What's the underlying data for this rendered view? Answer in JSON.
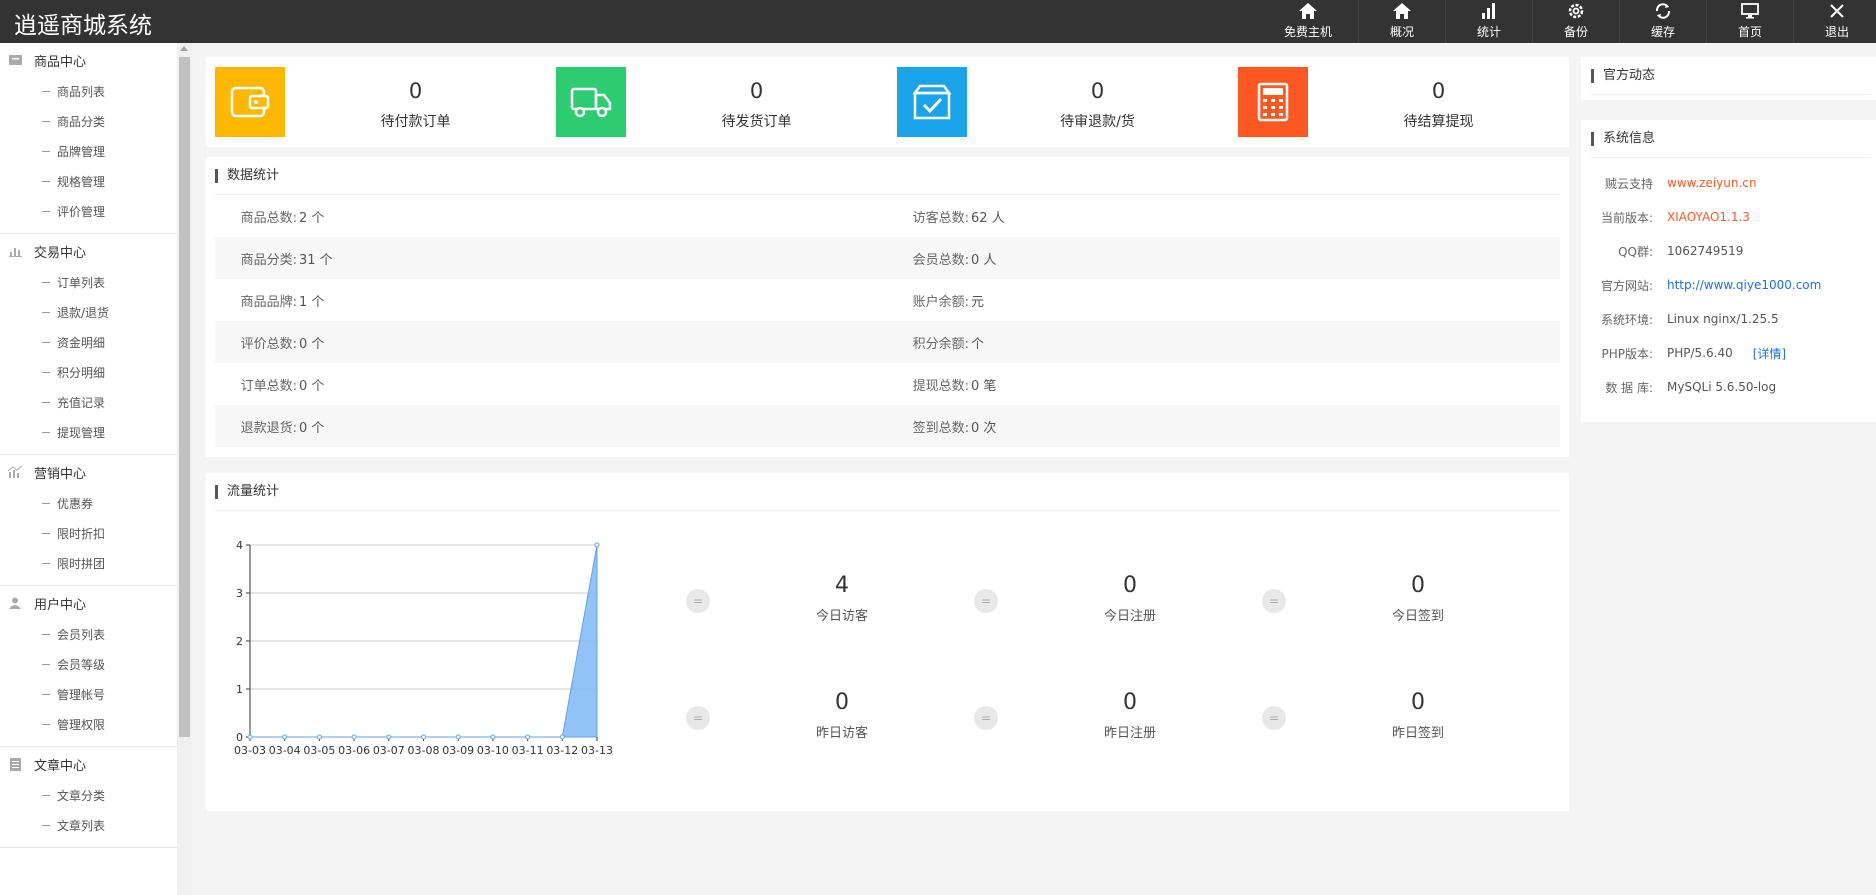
{
  "header": {
    "title": "逍遥商城系统",
    "nav": [
      {
        "label": "免费主机",
        "icon": "home-icon"
      },
      {
        "label": "概况",
        "icon": "home-icon"
      },
      {
        "label": "统计",
        "icon": "bar-chart-icon"
      },
      {
        "label": "备份",
        "icon": "gear-icon"
      },
      {
        "label": "缓存",
        "icon": "refresh-icon"
      },
      {
        "label": "首页",
        "icon": "monitor-icon"
      },
      {
        "label": "退出",
        "icon": "close-icon"
      }
    ]
  },
  "sidebar": {
    "groups": [
      {
        "title": "商品中心",
        "icon": "folder-icon",
        "items": [
          "商品列表",
          "商品分类",
          "品牌管理",
          "规格管理",
          "评价管理"
        ]
      },
      {
        "title": "交易中心",
        "icon": "bar-chart-icon",
        "items": [
          "订单列表",
          "退款/退货",
          "资金明细",
          "积分明细",
          "充值记录",
          "提现管理"
        ]
      },
      {
        "title": "营销中心",
        "icon": "chart-icon",
        "items": [
          "优惠券",
          "限时折扣",
          "限时拼团"
        ]
      },
      {
        "title": "用户中心",
        "icon": "user-icon",
        "items": [
          "会员列表",
          "会员等级",
          "管理帐号",
          "管理权限"
        ]
      },
      {
        "title": "文章中心",
        "icon": "document-icon",
        "items": [
          "文章分类",
          "文章列表"
        ]
      }
    ]
  },
  "stats": [
    {
      "value": "0",
      "label": "待付款订单",
      "color": "#ffb800",
      "icon": "wallet-icon"
    },
    {
      "value": "0",
      "label": "待发货订单",
      "color": "#2ecc71",
      "icon": "truck-icon"
    },
    {
      "value": "0",
      "label": "待审退款/货",
      "color": "#1aa3e8",
      "icon": "box-check-icon"
    },
    {
      "value": "0",
      "label": "待结算提现",
      "color": "#ff5722",
      "icon": "calculator-icon"
    }
  ],
  "data_stats": {
    "title": "数据统计",
    "rows": [
      [
        {
          "k": "商品总数:",
          "v": "2 个"
        },
        {
          "k": "访客总数:",
          "v": "62 人"
        }
      ],
      [
        {
          "k": "商品分类:",
          "v": "31 个"
        },
        {
          "k": "会员总数:",
          "v": "0 人"
        }
      ],
      [
        {
          "k": "商品品牌:",
          "v": "1 个"
        },
        {
          "k": "账户余额:",
          "v": "元"
        }
      ],
      [
        {
          "k": "评价总数:",
          "v": "0 个"
        },
        {
          "k": "积分余额:",
          "v": "个"
        }
      ],
      [
        {
          "k": "订单总数:",
          "v": "0 个"
        },
        {
          "k": "提现总数:",
          "v": "0 笔"
        }
      ],
      [
        {
          "k": "退款退货:",
          "v": "0 个"
        },
        {
          "k": "签到总数:",
          "v": "0 次"
        }
      ]
    ]
  },
  "flow": {
    "title": "流量统计",
    "stats": [
      {
        "value": "4",
        "label": "今日访客"
      },
      {
        "value": "0",
        "label": "今日注册"
      },
      {
        "value": "0",
        "label": "今日签到"
      },
      {
        "value": "0",
        "label": "昨日访客"
      },
      {
        "value": "0",
        "label": "昨日注册"
      },
      {
        "value": "0",
        "label": "昨日签到"
      }
    ],
    "eq_symbol": "="
  },
  "chart_data": {
    "type": "area",
    "x": [
      "03-03",
      "03-04",
      "03-05",
      "03-06",
      "03-07",
      "03-08",
      "03-09",
      "03-10",
      "03-11",
      "03-12",
      "03-13"
    ],
    "values": [
      0,
      0,
      0,
      0,
      0,
      0,
      0,
      0,
      0,
      0,
      4
    ],
    "yticks": [
      "0",
      "1",
      "2",
      "3",
      "4"
    ],
    "ylim": [
      0,
      4
    ],
    "grid": true,
    "color": "#7fb8f5"
  },
  "news": {
    "title": "官方动态"
  },
  "system": {
    "title": "系统信息",
    "rows": [
      {
        "k": "贼云支持",
        "v": "www.zeiyun.cn",
        "style": "orange"
      },
      {
        "k": "当前版本:",
        "v": "XIAOYAO1.1.3",
        "style": "orange"
      },
      {
        "k": "QQ群:",
        "v": "1062749519",
        "style": ""
      },
      {
        "k": "官方网站:",
        "v": "http://www.qiye1000.com",
        "style": "blue"
      },
      {
        "k": "系统环境:",
        "v": "Linux nginx/1.25.5",
        "style": ""
      },
      {
        "k": "PHP版本:",
        "v": "PHP/5.6.40",
        "style": "",
        "extra": "[详情]"
      },
      {
        "k": "数 据 库:",
        "v": "MySQLi 5.6.50-log",
        "style": ""
      }
    ]
  }
}
